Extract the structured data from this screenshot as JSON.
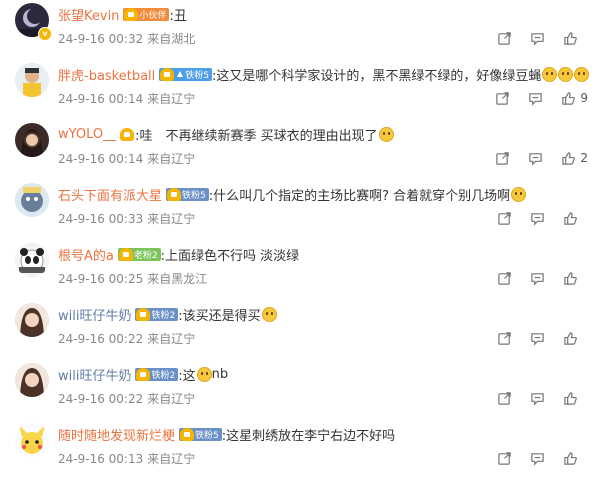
{
  "comments": [
    {
      "user": "张望Kevin",
      "user_color": "orange",
      "badge": "小伙伴",
      "badge_style": "orange",
      "has_arrow": false,
      "text": ":丑",
      "emojis": 0,
      "date": "24-9-16 00:32",
      "location": "来自湖北",
      "likes": "",
      "avatar": "dark-moon"
    },
    {
      "user": "胖虎-basketball",
      "user_color": "orange",
      "badge": "铁粉5",
      "badge_style": "blue",
      "has_arrow": true,
      "text": ":这又是哪个科学家设计的，黑不黑绿不绿的，好像绿豆蝇",
      "emojis": 3,
      "date": "24-9-16 00:14",
      "location": "来自辽宁",
      "likes": "9",
      "avatar": "man-yellow"
    },
    {
      "user": "wYOLO__",
      "user_color": "orange",
      "badge": "",
      "badge_style": "crown",
      "has_arrow": false,
      "text": ":哇　不再继续新赛季 买球衣的理由出现了",
      "emojis": 1,
      "date": "24-9-16 00:14",
      "location": "来自辽宁",
      "likes": "2",
      "avatar": "girl-dark"
    },
    {
      "user": "石头下面有派大星",
      "user_color": "orange",
      "badge": "铁粉5",
      "badge_style": "iron",
      "has_arrow": false,
      "text": ":什么叫几个指定的主场比赛啊? 合着就穿个别几场啊",
      "emojis": 1,
      "date": "24-9-16 00:33",
      "location": "来自辽宁",
      "likes": "",
      "avatar": "cartoon"
    },
    {
      "user": "根号A的a",
      "user_color": "orange",
      "badge": "老粉2",
      "badge_style": "green",
      "has_arrow": false,
      "text": ":上面绿色不行吗 淡淡绿",
      "emojis": 0,
      "date": "24-9-16 00:25",
      "location": "来自黑龙江",
      "likes": "",
      "avatar": "panda"
    },
    {
      "user": "wili旺仔牛奶",
      "user_color": "blue",
      "badge": "铁粉2",
      "badge_style": "iron",
      "has_arrow": false,
      "text": ":该买还是得买",
      "emojis": 1,
      "date": "24-9-16 00:22",
      "location": "来自辽宁",
      "likes": "",
      "avatar": "girl-light"
    },
    {
      "user": "wili旺仔牛奶",
      "user_color": "blue",
      "badge": "铁粉2",
      "badge_style": "iron",
      "has_arrow": false,
      "text": ":这",
      "text_after": "nb",
      "emojis": 1,
      "date": "24-9-16 00:22",
      "location": "来自辽宁",
      "likes": "",
      "avatar": "girl-light"
    },
    {
      "user": "随时随地发现新烂梗",
      "user_color": "orange",
      "badge": "铁粉5",
      "badge_style": "iron",
      "has_arrow": false,
      "text": ":这星刺绣放在李宁右边不好吗",
      "emojis": 0,
      "date": "24-9-16 00:13",
      "location": "来自辽宁",
      "likes": "",
      "avatar": "pikachu"
    }
  ],
  "icons": {
    "share": "share-icon",
    "reply": "comment-icon",
    "like": "thumbs-up-icon",
    "verified": "verified-badge-icon"
  },
  "colors": {
    "username_orange": "#eb7340",
    "username_blue": "#5f7ba6",
    "meta_gray": "#888888"
  }
}
